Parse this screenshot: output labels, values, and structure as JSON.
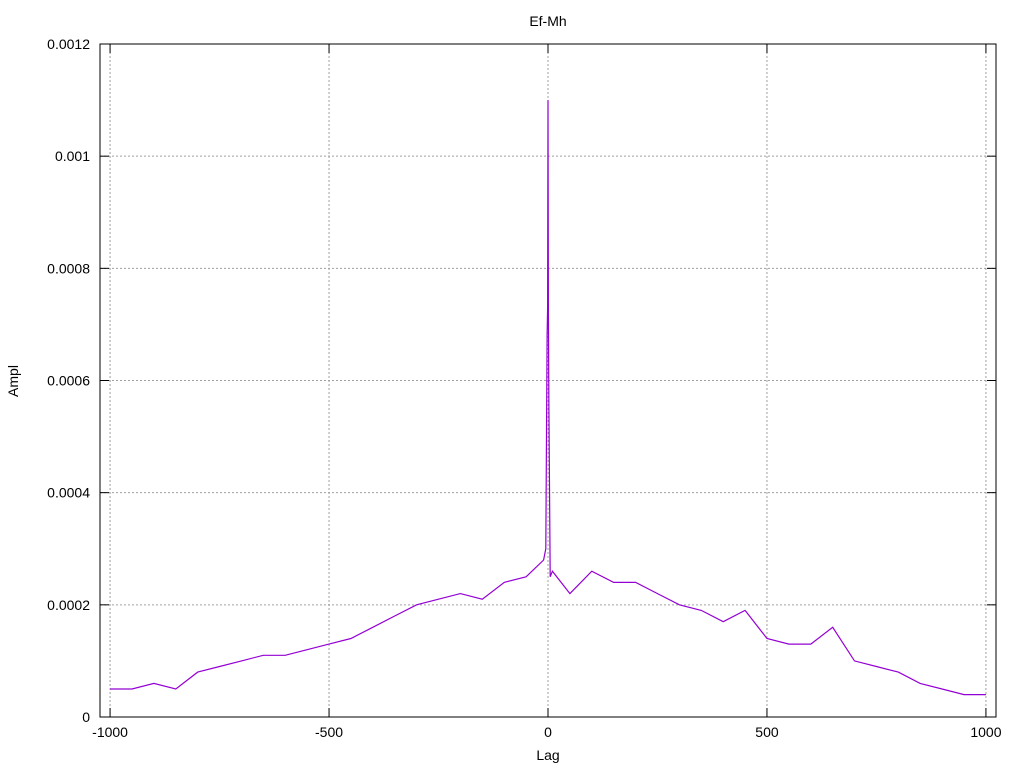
{
  "chart_data": {
    "type": "line",
    "title": "Ef-Mh",
    "xlabel": "Lag",
    "ylabel": "Ampl",
    "xlim": [
      -1023,
      1023
    ],
    "ylim": [
      0,
      0.0012
    ],
    "x_ticks": [
      -1000,
      -500,
      0,
      500,
      1000
    ],
    "x_tick_labels": [
      "-1000",
      "-500",
      "0",
      "500",
      "1000"
    ],
    "y_ticks": [
      0,
      0.0002,
      0.0004,
      0.0006,
      0.0008,
      0.001,
      0.0012
    ],
    "y_tick_labels": [
      "0",
      "0.0002",
      "0.0004",
      "0.0006",
      "0.0008",
      "0.001",
      "0.0012"
    ],
    "grid": true,
    "legend": "none",
    "color": "#9400d3",
    "series": [
      {
        "x": [
          -1000,
          -950,
          -900,
          -850,
          -800,
          -750,
          -700,
          -650,
          -600,
          -550,
          -500,
          -450,
          -400,
          -350,
          -300,
          -250,
          -200,
          -150,
          -100,
          -50,
          -10,
          -5,
          -2,
          -1,
          0,
          1,
          2,
          5,
          10,
          50,
          100,
          150,
          200,
          250,
          300,
          350,
          400,
          450,
          500,
          550,
          600,
          650,
          700,
          750,
          800,
          850,
          900,
          950,
          1000
        ],
        "y": [
          5e-05,
          5e-05,
          6e-05,
          5e-05,
          8e-05,
          9e-05,
          0.0001,
          0.00011,
          0.00011,
          0.00012,
          0.00013,
          0.00014,
          0.00016,
          0.00018,
          0.0002,
          0.00021,
          0.00022,
          0.00021,
          0.00024,
          0.00025,
          0.00028,
          0.0003,
          0.00068,
          0.00073,
          0.0011,
          0.00072,
          0.00055,
          0.00025,
          0.00026,
          0.00022,
          0.00026,
          0.00024,
          0.00024,
          0.00022,
          0.0002,
          0.00019,
          0.00017,
          0.00019,
          0.00014,
          0.00013,
          0.00013,
          0.00016,
          0.0001,
          9e-05,
          8e-05,
          6e-05,
          5e-05,
          4e-05,
          4e-05
        ]
      }
    ]
  }
}
